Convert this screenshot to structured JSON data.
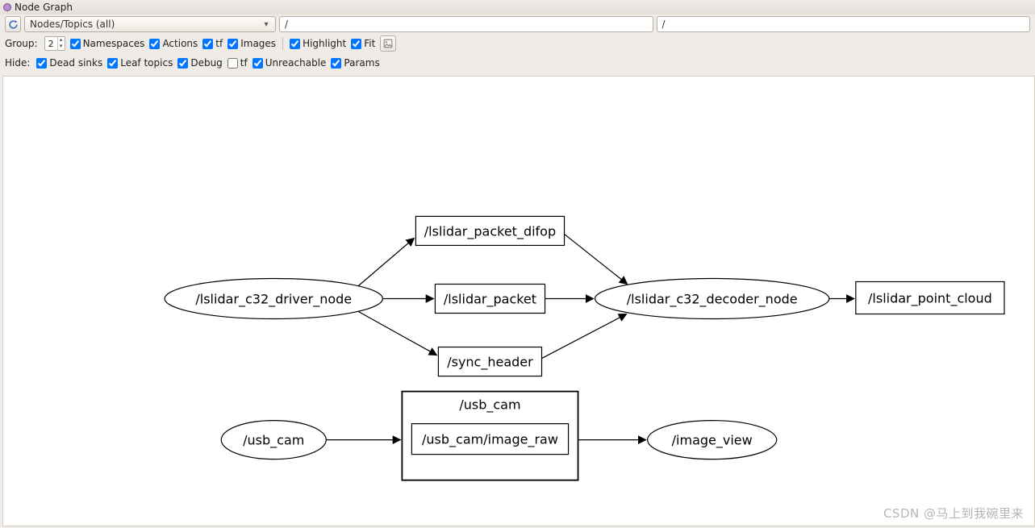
{
  "window": {
    "title": "Node Graph"
  },
  "toolbar": {
    "filter_mode": "Nodes/Topics (all)",
    "filter_text1": "/",
    "filter_text2": "/"
  },
  "group_row": {
    "label": "Group:",
    "value": "2",
    "namespaces": "Namespaces",
    "actions": "Actions",
    "tf": "tf",
    "images": "Images",
    "highlight": "Highlight",
    "fit": "Fit"
  },
  "hide_row": {
    "label": "Hide:",
    "dead_sinks": "Dead sinks",
    "leaf_topics": "Leaf topics",
    "debug": "Debug",
    "tf": "tf",
    "unreachable": "Unreachable",
    "params": "Params"
  },
  "graph": {
    "nodes": {
      "driver": "/lslidar_c32_driver_node",
      "decoder": "/lslidar_c32_decoder_node",
      "usb_cam": "/usb_cam",
      "image_view": "/image_view"
    },
    "topics": {
      "difop": "/lslidar_packet_difop",
      "packet": "/lslidar_packet",
      "sync": "/sync_header",
      "point_cloud": "/lslidar_point_cloud",
      "usb_cam_ns": "/usb_cam",
      "image_raw": "/usb_cam/image_raw"
    }
  },
  "watermark": "CSDN @马上到我碗里来"
}
